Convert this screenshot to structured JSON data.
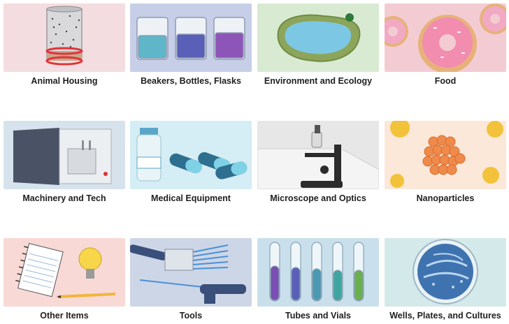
{
  "categories": [
    {
      "label": "Animal Housing",
      "icon": "animal-cage-icon",
      "bg": "#f4dde0"
    },
    {
      "label": "Beakers, Bottles, Flasks",
      "icon": "beakers-icon",
      "bg": "#c7cfe8"
    },
    {
      "label": "Environment and Ecology",
      "icon": "pond-icon",
      "bg": "#d8ead2"
    },
    {
      "label": "Food",
      "icon": "donut-icon",
      "bg": "#f3ccd3"
    },
    {
      "label": "Machinery and Tech",
      "icon": "lab-machine-icon",
      "bg": "#d6e3ec"
    },
    {
      "label": "Medical Equipment",
      "icon": "vial-capsules-icon",
      "bg": "#d5edf4"
    },
    {
      "label": "Microscope and Optics",
      "icon": "microscope-icon",
      "bg": "#e7e7e7"
    },
    {
      "label": "Nanoparticles",
      "icon": "nanoparticles-icon",
      "bg": "#fbe8d8"
    },
    {
      "label": "Other Items",
      "icon": "notebook-lightbulb-icon",
      "bg": "#f8d9d6"
    },
    {
      "label": "Tools",
      "icon": "pipette-icon",
      "bg": "#cdd6e6"
    },
    {
      "label": "Tubes and Vials",
      "icon": "test-tubes-icon",
      "bg": "#c9e0ec"
    },
    {
      "label": "Wells, Plates, and Cultures",
      "icon": "petri-dish-icon",
      "bg": "#d3e9ea"
    }
  ]
}
